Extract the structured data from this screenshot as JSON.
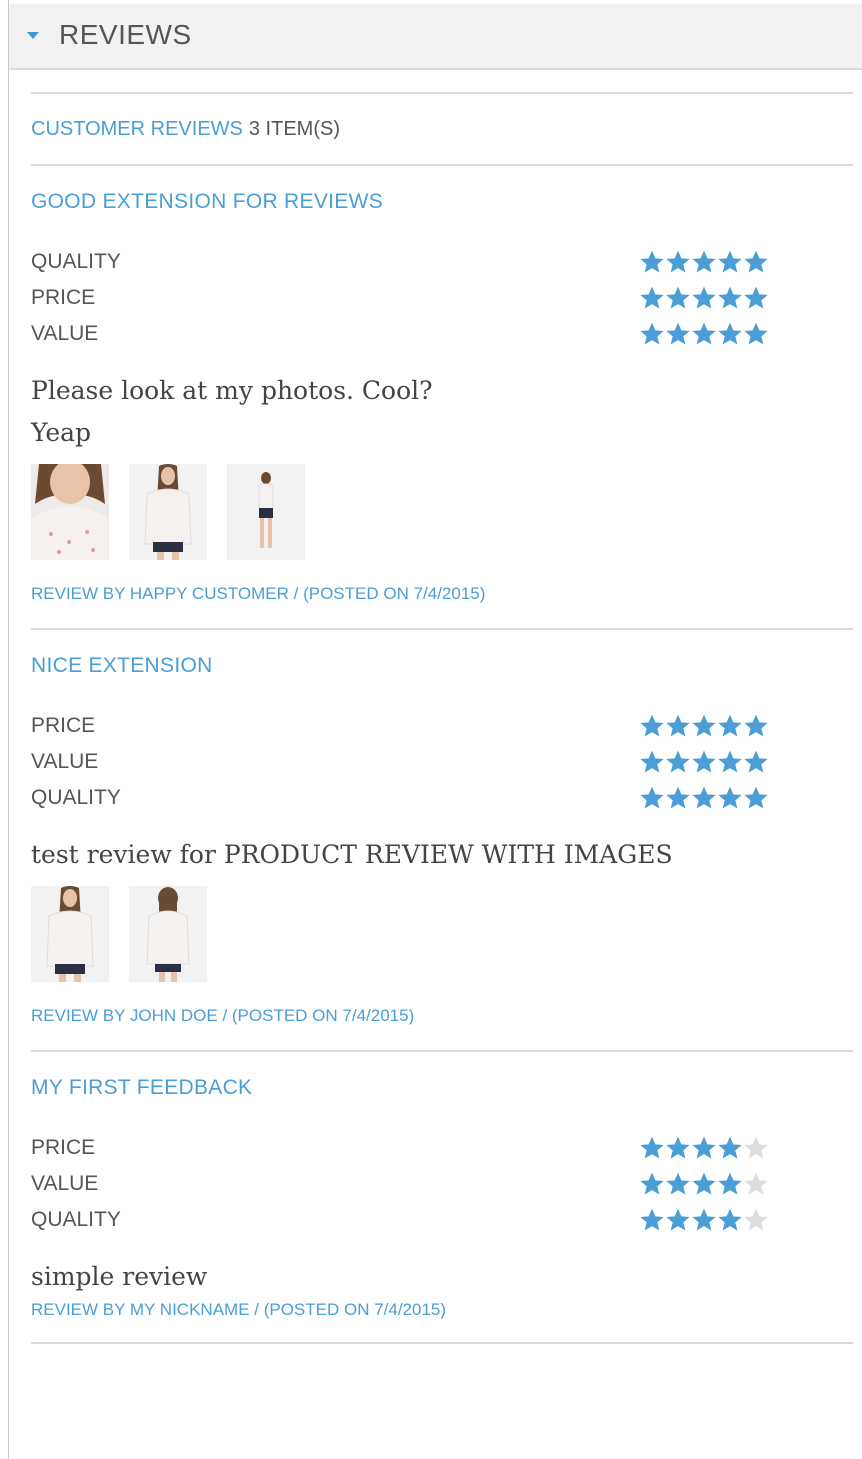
{
  "tab": {
    "title": "REVIEWS"
  },
  "summary": {
    "label": "CUSTOMER REVIEWS",
    "count": "3 ITEM(S)"
  },
  "star_color": "#4a9ed6",
  "star_empty_color": "#dddddd",
  "reviews": [
    {
      "title": "GOOD EXTENSION FOR REVIEWS",
      "ratings": [
        {
          "label": "QUALITY",
          "stars": 5
        },
        {
          "label": "PRICE",
          "stars": 5
        },
        {
          "label": "VALUE",
          "stars": 5
        }
      ],
      "text": "Please look at my photos. Cool?",
      "text2": "Yeap",
      "photos": [
        "face-photo",
        "model-photo",
        "full-body-photo"
      ],
      "byline": "REVIEW BY HAPPY CUSTOMER / (POSTED ON 7/4/2015)"
    },
    {
      "title": "NICE EXTENSION",
      "ratings": [
        {
          "label": "PRICE",
          "stars": 5
        },
        {
          "label": "VALUE",
          "stars": 5
        },
        {
          "label": "QUALITY",
          "stars": 5
        }
      ],
      "text": "test review for PRODUCT REVIEW WITH IMAGES",
      "photos": [
        "model-photo",
        "model-back-photo"
      ],
      "byline": "REVIEW BY JOHN DOE / (POSTED ON 7/4/2015)"
    },
    {
      "title": "MY FIRST FEEDBACK",
      "ratings": [
        {
          "label": "PRICE",
          "stars": 4
        },
        {
          "label": "VALUE",
          "stars": 4
        },
        {
          "label": "QUALITY",
          "stars": 4
        }
      ],
      "text": "simple review",
      "photos": [],
      "byline": "REVIEW BY MY NICKNAME / (POSTED ON 7/4/2015)"
    }
  ]
}
